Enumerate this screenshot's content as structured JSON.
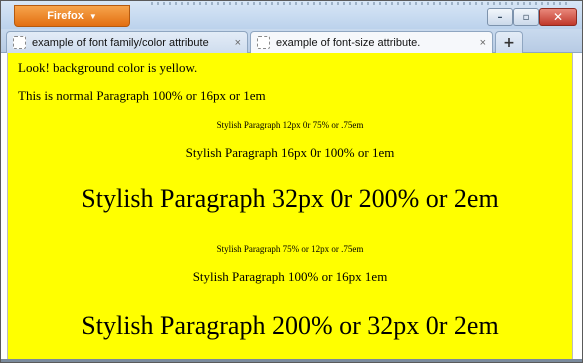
{
  "browser": {
    "menu_button": "Firefox",
    "window_controls": {
      "minimize": "–",
      "maximize": "▫",
      "close": "✕"
    },
    "tabs": [
      {
        "label": "example of font family/color attribute",
        "close": "×"
      },
      {
        "label": "example of font-size attribute.",
        "close": "×"
      }
    ],
    "new_tab": "+"
  },
  "page": {
    "background": "#ffff00",
    "lines": [
      "Look! background color is yellow.",
      "This is normal Paragraph 100% or 16px or 1em",
      "Stylish Paragraph 12px 0r 75% or .75em",
      "Stylish Paragraph 16px 0r 100% or 1em",
      "Stylish Paragraph 32px 0r 200% or 2em",
      "Stylish Paragraph 75% or 12px or .75em",
      "Stylish Paragraph 100% or 16px 1em",
      "Stylish Paragraph 200% or 32px 0r 2em"
    ]
  }
}
